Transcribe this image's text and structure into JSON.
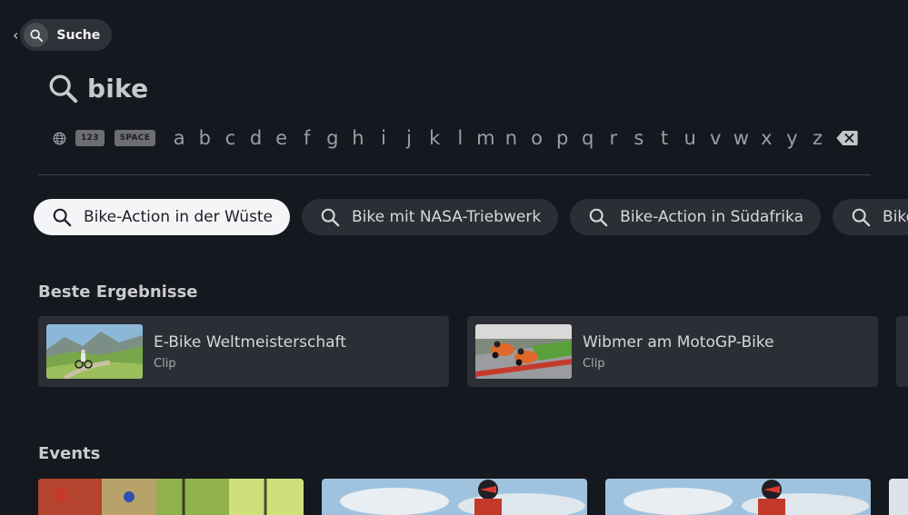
{
  "header": {
    "back_chevron": "‹",
    "search_label": "Suche"
  },
  "query": {
    "value": "bike"
  },
  "keyboard": {
    "numbers_key": "123",
    "space_key": "SPACE",
    "letters": [
      "a",
      "b",
      "c",
      "d",
      "e",
      "f",
      "g",
      "h",
      "i",
      "j",
      "k",
      "l",
      "m",
      "n",
      "o",
      "p",
      "q",
      "r",
      "s",
      "t",
      "u",
      "v",
      "w",
      "x",
      "y",
      "z"
    ]
  },
  "suggestions": [
    {
      "label": "Bike-Action in der Wüste"
    },
    {
      "label": "Bike mit NASA-Triebwerk"
    },
    {
      "label": "Bike-Action in Südafrika"
    },
    {
      "label": "Bike-A"
    }
  ],
  "best_results": {
    "title": "Beste Ergebnisse",
    "items": [
      {
        "title": "E-Bike Weltmeisterschaft",
        "type": "Clip"
      },
      {
        "title": "Wibmer am MotoGP-Bike",
        "type": "Clip"
      }
    ]
  },
  "events": {
    "title": "Events"
  },
  "colors": {
    "background": "#16181f",
    "chip": "#2c2e35",
    "active_chip": "#f4f5f7"
  }
}
